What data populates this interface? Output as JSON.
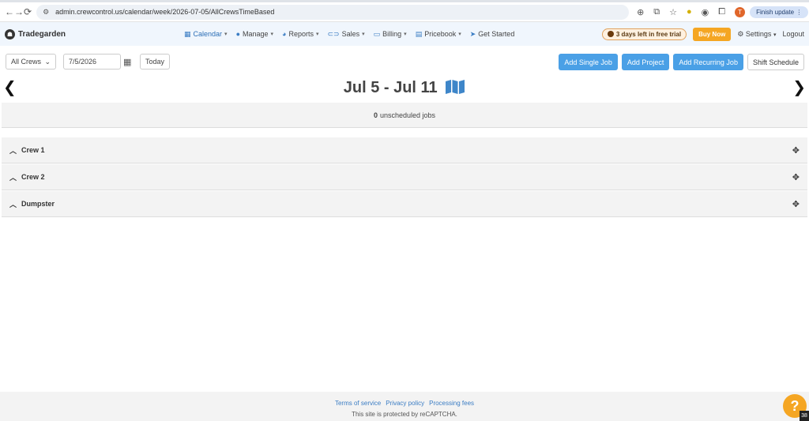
{
  "browser": {
    "url": "admin.crewcontrol.us/calendar/week/2026-07-05/AllCrewsTimeBased",
    "profile_initial": "T",
    "finish_update": "Finish update"
  },
  "nav": {
    "brand": "Tradegarden",
    "menu": [
      {
        "label": "Calendar",
        "icon": "calendar-icon"
      },
      {
        "label": "Manage",
        "icon": "person-icon"
      },
      {
        "label": "Reports",
        "icon": "pie-chart-icon"
      },
      {
        "label": "Sales",
        "icon": "ticket-icon"
      },
      {
        "label": "Billing",
        "icon": "card-icon"
      },
      {
        "label": "Pricebook",
        "icon": "book-icon"
      },
      {
        "label": "Get Started",
        "icon": "paper-plane-icon"
      }
    ],
    "trial": "3 days left in free trial",
    "buy_now": "Buy Now",
    "settings": "Settings",
    "logout": "Logout"
  },
  "toolbar": {
    "crew_select": "All Crews",
    "date": "7/5/2026",
    "today": "Today",
    "add_single_job": "Add Single Job",
    "add_project": "Add Project",
    "add_recurring_job": "Add Recurring Job",
    "shift_schedule": "Shift Schedule"
  },
  "week": {
    "title": "Jul 5 - Jul 11"
  },
  "unscheduled": {
    "count": "0",
    "label": "unscheduled jobs"
  },
  "crews": [
    {
      "name": "Crew 1"
    },
    {
      "name": "Crew 2"
    },
    {
      "name": "Dumpster"
    }
  ],
  "footer": {
    "terms": "Terms of service",
    "privacy": "Privacy policy",
    "fees": "Processing fees",
    "recaptcha": "This site is protected by reCAPTCHA."
  },
  "help": {
    "label": "?",
    "badge": "38"
  },
  "colors": {
    "accent": "#4aa0e6",
    "buy_now": "#f5a623",
    "nav_bg": "#f0f6fd"
  }
}
